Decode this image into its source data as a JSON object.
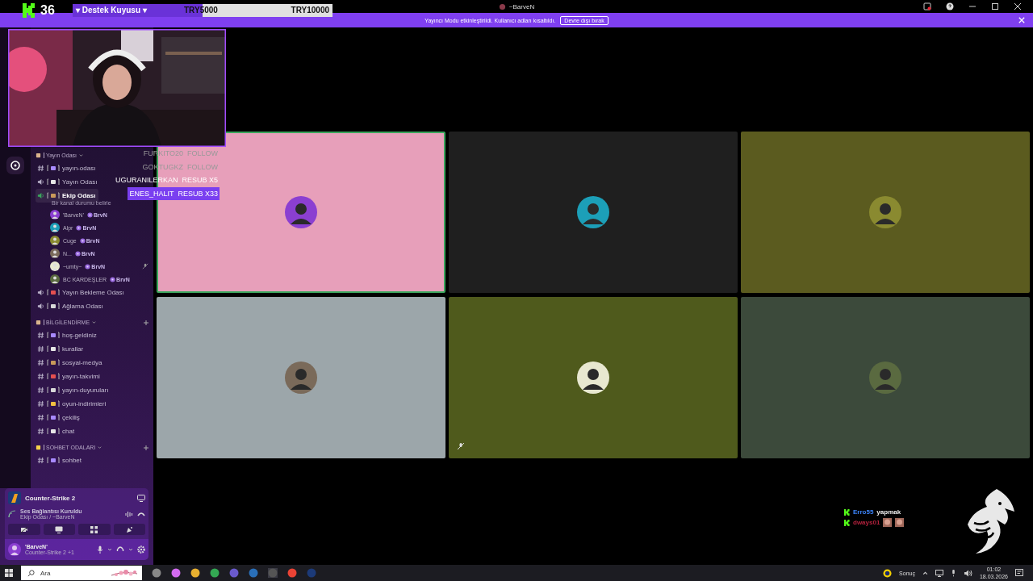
{
  "window": {
    "title": "~BarveN"
  },
  "banner": {
    "text": "Yayıncı Modu etkinleştirildi. Kullanıcı adları kısaltıldı.",
    "button": "Devre dışı bırak"
  },
  "goal": {
    "count": "36",
    "title": "▾ Destek Kuyusu ▾",
    "current": "TRY5000",
    "target": "TRY10000",
    "level": 0.5
  },
  "alerts": [
    {
      "user": "FURKITO20",
      "event": "FOLLOW",
      "faded": true,
      "highlighted": false
    },
    {
      "user": "GOKTUGKZ",
      "event": "FOLLOW",
      "faded": true,
      "highlighted": false
    },
    {
      "user": "UGURANILERKAN",
      "event": "RESUB X5",
      "faded": false,
      "highlighted": false
    },
    {
      "user": "ENES_HALIT",
      "event": "RESUB X33",
      "faded": false,
      "highlighted": true
    }
  ],
  "channel_groups": [
    {
      "name": "Yayın Odası",
      "channels": [
        {
          "kind": "text",
          "name": "yayın-odası",
          "selected": false
        },
        {
          "kind": "voice",
          "name": "Yayın Odası",
          "selected": false
        },
        {
          "kind": "voice",
          "name": "Ekip Odası",
          "selected": true,
          "status": "Bir kanal durumu belirle",
          "members": [
            {
              "name": "'BarveN'",
              "tag": "BrvN",
              "muted": false
            },
            {
              "name": "Alpr",
              "tag": "BrvN",
              "muted": false
            },
            {
              "name": "Cuge",
              "tag": "BrvN",
              "muted": false
            },
            {
              "name": "N...",
              "tag": "BrvN",
              "muted": false
            },
            {
              "name": "~umty~",
              "tag": "BrvN",
              "muted": true
            },
            {
              "name": "BC KARDEŞLER",
              "tag": "BrvN",
              "muted": false
            }
          ]
        },
        {
          "kind": "voice",
          "name": "Yayın Bekleme Odası",
          "selected": false
        },
        {
          "kind": "voice",
          "name": "Ağlama Odası",
          "selected": false
        }
      ]
    },
    {
      "name": "BİLGİLENDİRME",
      "channels": [
        {
          "kind": "text",
          "name": "hoş-geldiniz",
          "selected": false
        },
        {
          "kind": "text",
          "name": "kurallar",
          "selected": false
        },
        {
          "kind": "text",
          "name": "sosyal-medya",
          "selected": false
        },
        {
          "kind": "text",
          "name": "yayın-takvimi",
          "selected": false
        },
        {
          "kind": "text",
          "name": "yayın-duyuruları",
          "selected": false
        },
        {
          "kind": "text",
          "name": "oyun-indirimleri",
          "selected": false
        },
        {
          "kind": "text",
          "name": "çekiliş",
          "selected": false
        },
        {
          "kind": "text",
          "name": "chat",
          "selected": false
        }
      ]
    },
    {
      "name": "SOHBET ODALARI",
      "channels": [
        {
          "kind": "text",
          "name": "sohbet",
          "selected": false
        }
      ]
    }
  ],
  "panel": {
    "activity": "Counter-Strike 2",
    "voice_status": "Ses Bağlantısı Kuruldu",
    "voice_channel": "Ekip Odası / ~BarveN",
    "user": "'BarveN'",
    "user_status": "Counter-Strike 2 +1"
  },
  "tiles": [
    {
      "color": "#e79fba",
      "speaking": true,
      "muted": false
    },
    {
      "color": "#1f1f1f",
      "speaking": false,
      "muted": false
    },
    {
      "color": "#5b5b1f",
      "speaking": false,
      "muted": false
    },
    {
      "color": "#9ca6aa",
      "speaking": false,
      "muted": false
    },
    {
      "color": "#4f5a1c",
      "speaking": false,
      "muted": true
    },
    {
      "color": "#3c4a3b",
      "speaking": false,
      "muted": false
    }
  ],
  "chat": [
    {
      "user": "Erro55",
      "color": "#3b82f6",
      "message": "yapmak"
    },
    {
      "user": "dways01",
      "color": "#b3213d",
      "kind": "emotes"
    }
  ],
  "taskbar": {
    "search_placeholder": "Ara",
    "weather": "Sonuç",
    "time": "01:02",
    "date": "18.03.2026"
  }
}
